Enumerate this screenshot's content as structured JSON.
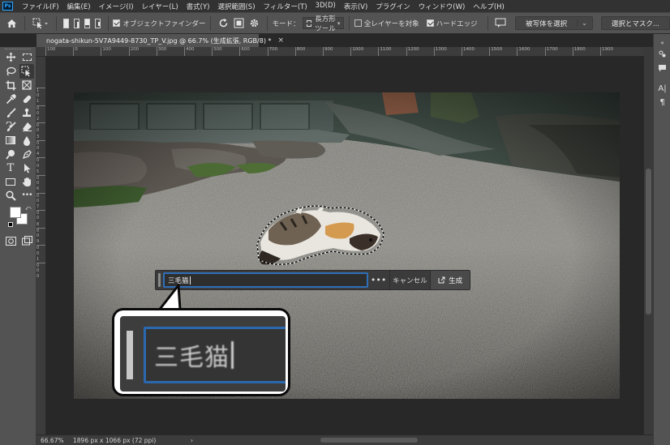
{
  "app": {
    "logo": "Ps",
    "menu": [
      "ファイル(F)",
      "編集(E)",
      "イメージ(I)",
      "レイヤー(L)",
      "書式(Y)",
      "選択範囲(S)",
      "フィルター(T)",
      "3D(D)",
      "表示(V)",
      "プラグイン",
      "ウィンドウ(W)",
      "ヘルプ(H)"
    ]
  },
  "options": {
    "object_finder_label": "オブジェクトファインダー",
    "mode_label": "モード：",
    "mode_value": "長方形ツール",
    "sample_all_layers_label": "全レイヤーを対象",
    "sample_all_layers_checked": false,
    "hard_edge_label": "ハードエッジ",
    "hard_edge_checked": true,
    "object_finder_checked": true,
    "select_subject_label": "被写体を選択",
    "select_and_mask_label": "選択とマスク..."
  },
  "document": {
    "tab_title": "nogata-shikun-5V7A9449-8730_TP_V.jpg @ 66.7% (生成拡張, RGB/8) *",
    "close_glyph": "×"
  },
  "rulers": {
    "top_labels": [
      "100",
      "0",
      "100",
      "200",
      "300",
      "400",
      "500",
      "600",
      "700",
      "800",
      "900",
      "1000",
      "1100",
      "1200",
      "1300",
      "1400",
      "1500",
      "1600",
      "1700",
      "1800",
      "1900"
    ],
    "left_labels": [
      "1",
      "0",
      "1",
      "0",
      "0",
      "2",
      "0",
      "0",
      "3",
      "0",
      "0",
      "4",
      "0",
      "0",
      "5",
      "0",
      "0",
      "6",
      "0",
      "0",
      "7",
      "0",
      "0",
      "8",
      "0",
      "0",
      "9",
      "0",
      "0",
      "1",
      "0",
      "0",
      "0"
    ]
  },
  "taskbar": {
    "prompt_value": "三毛猫",
    "more_glyph": "•••",
    "cancel_label": "キャンセル",
    "generate_label": "生成"
  },
  "callout": {
    "zoom_text": "三毛猫"
  },
  "status": {
    "zoom": "66.67%",
    "doc_info": "1896 px x 1066 px (72 ppi)",
    "arrow": "›"
  },
  "colors": {
    "accent": "#2f6fb8",
    "workspace": "#282828",
    "panel": "#535353"
  }
}
